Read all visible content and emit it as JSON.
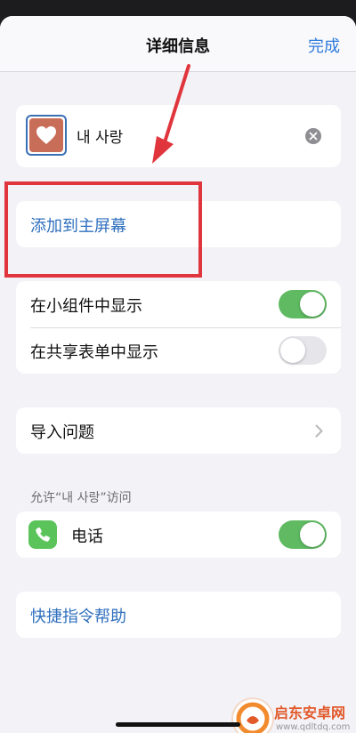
{
  "nav": {
    "title": "详细信息",
    "done_label": "完成"
  },
  "shortcut": {
    "name": "내 사랑",
    "icon": "heart-icon",
    "tile_color": "#c86d58"
  },
  "actions": {
    "add_to_home": "添加到主屏幕"
  },
  "toggles": [
    {
      "label": "在小组件中显示",
      "on": true
    },
    {
      "label": "在共享表单中显示",
      "on": false
    }
  ],
  "import": {
    "label": "导入问题"
  },
  "permissions": {
    "caption": "允许“내 사랑”访问",
    "items": [
      {
        "label": "电话",
        "icon": "phone-icon",
        "on": true
      }
    ]
  },
  "help": {
    "label": "快捷指令帮助"
  },
  "watermark": {
    "title": "启东安卓网",
    "url": "www.qdltdq.com"
  },
  "colors": {
    "accent": "#2f7bdc",
    "switch_on": "#5fba62",
    "annotation": "#e0353c"
  }
}
